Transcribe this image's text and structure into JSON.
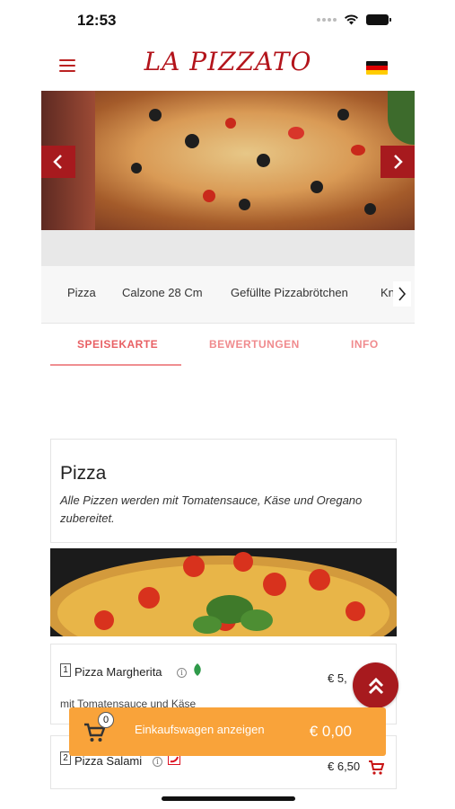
{
  "status_bar": {
    "time": "12:53"
  },
  "header": {
    "brand": "LA PIZZATO",
    "language_flag": "de-flag-icon"
  },
  "colors": {
    "brand_red": "#a71a1e",
    "tab_pink": "#f08b8e",
    "cart_orange": "#f9a33a"
  },
  "categories": {
    "items": [
      "Pizza",
      "Calzone 28 Cm",
      "Gefüllte Pizzabrötchen",
      "Kn"
    ]
  },
  "tabs": [
    {
      "label": "SPEISEKARTE",
      "active": true
    },
    {
      "label": "BEWERTUNGEN",
      "active": false
    },
    {
      "label": "INFO",
      "active": false
    }
  ],
  "section": {
    "title": "Pizza",
    "description": "Alle Pizzen werden mit Tomatensauce, Käse und Oregano zubereitet."
  },
  "products": [
    {
      "number": "1",
      "name": "Pizza Margherita",
      "price": "€ 5,",
      "description": "mit Tomatensauce und Käse",
      "icons": [
        "info-icon",
        "vegetarian-leaf-icon"
      ]
    },
    {
      "number": "2",
      "name": "Pizza Salami",
      "price": "€ 6,50",
      "icons": [
        "info-icon",
        "chili-icon",
        "cart-icon"
      ]
    }
  ],
  "cart": {
    "count": "0",
    "label": "Einkaufswagen anzeigen",
    "total": "€ 0,00"
  }
}
